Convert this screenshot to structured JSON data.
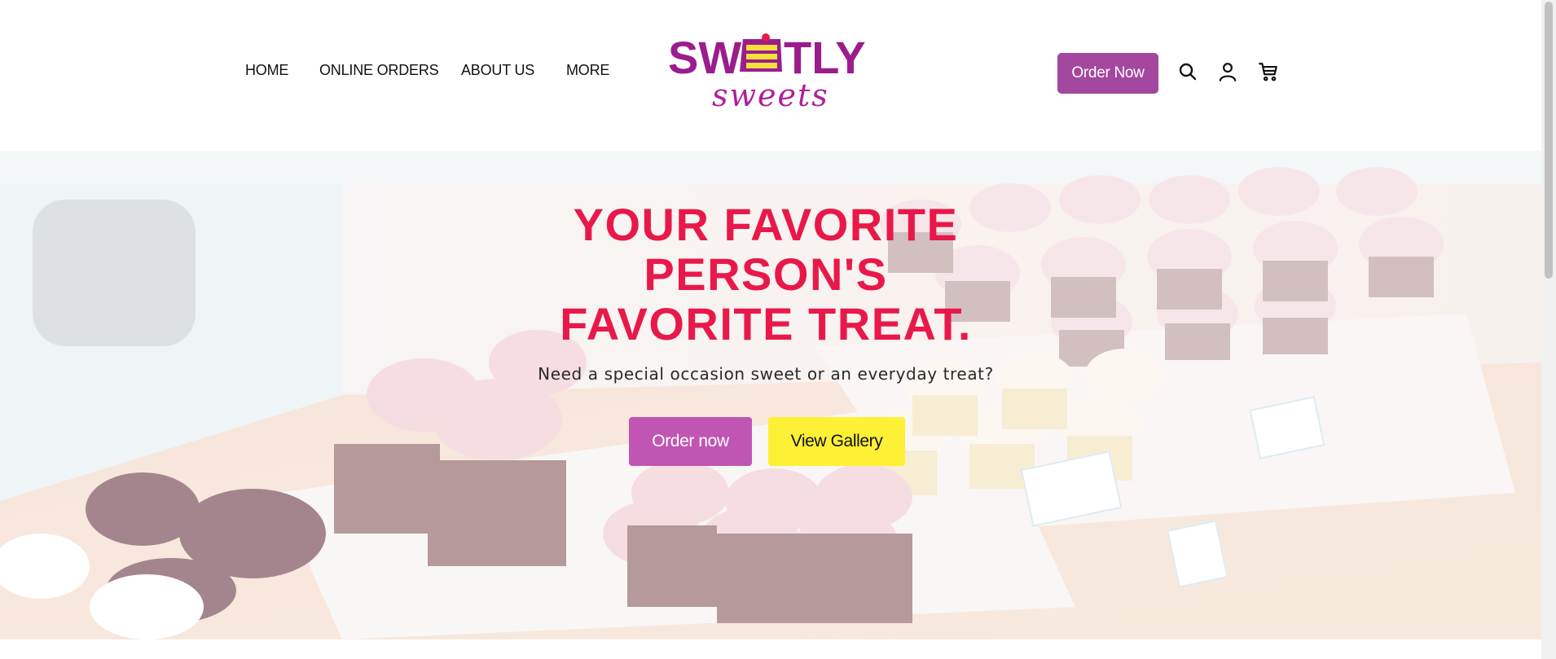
{
  "nav": {
    "items": [
      {
        "label": "HOME"
      },
      {
        "label": "ONLINE ORDERS"
      },
      {
        "label": "ABOUT US"
      },
      {
        "label": "MORE"
      }
    ]
  },
  "logo": {
    "text_top": "SWEETLY",
    "text_bottom": "sweets",
    "colors": {
      "purple": "#9b1c8c",
      "magenta": "#b01e9a",
      "yellow": "#f5e13a",
      "red": "#e8194a"
    }
  },
  "header": {
    "order_label": "Order Now",
    "icons": [
      "search-icon",
      "account-icon",
      "cart-icon"
    ]
  },
  "hero": {
    "title_lines": [
      "YOUR FAVORITE",
      "PERSON'S",
      "FAVORITE TREAT."
    ],
    "subtitle": "Need a special occasion sweet or an everyday treat?",
    "primary_label": "Order now",
    "secondary_label": "View Gallery"
  },
  "colors": {
    "accent_purple": "#a4479f",
    "button_purple": "#c055b3",
    "button_yellow": "#fdf035",
    "title_red": "#e8194a"
  }
}
